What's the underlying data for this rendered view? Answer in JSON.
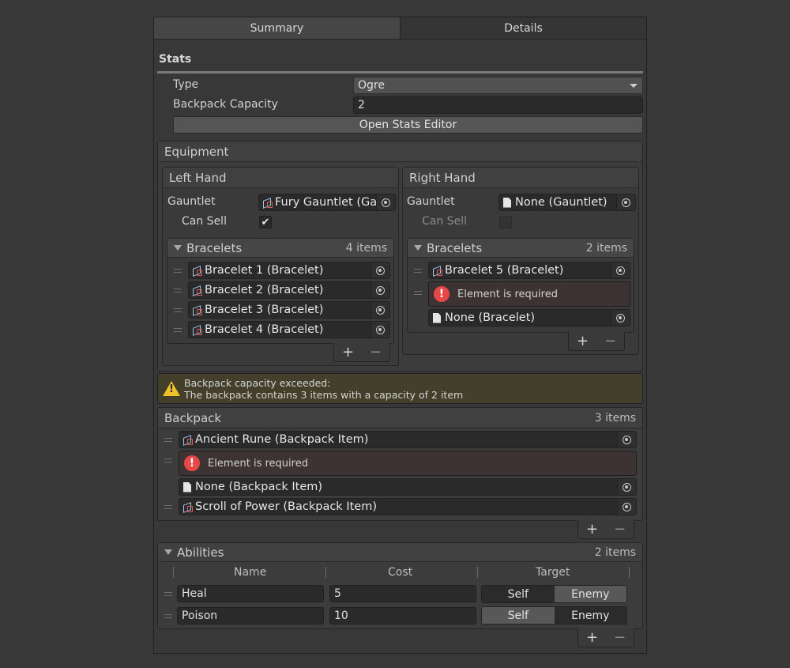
{
  "tabs": [
    "Summary",
    "Details"
  ],
  "stats": {
    "header": "Stats",
    "type_label": "Type",
    "type_value": "Ogre",
    "capacity_label": "Backpack Capacity",
    "capacity_value": "2",
    "open_button": "Open Stats Editor"
  },
  "equipment": {
    "header": "Equipment",
    "left": {
      "title": "Left Hand",
      "gauntlet_label": "Gauntlet",
      "gauntlet_value": "Fury Gauntlet (Gau",
      "can_sell_label": "Can Sell",
      "can_sell_checked": true,
      "bracelets_label": "Bracelets",
      "bracelets_count": "4 items",
      "bracelets": [
        "Bracelet 1 (Bracelet)",
        "Bracelet 2 (Bracelet)",
        "Bracelet 3 (Bracelet)",
        "Bracelet 4 (Bracelet)"
      ]
    },
    "right": {
      "title": "Right Hand",
      "gauntlet_label": "Gauntlet",
      "gauntlet_value": "None (Gauntlet)",
      "can_sell_label": "Can Sell",
      "can_sell_checked": false,
      "bracelets_label": "Bracelets",
      "bracelets_count": "2 items",
      "bracelet_1": "Bracelet 5 (Bracelet)",
      "error": "Element is required",
      "bracelet_2": "None (Bracelet)"
    }
  },
  "warning": {
    "line1": "Backpack capacity exceeded:",
    "line2": "The backpack contains 3 items with a capacity of 2 item"
  },
  "backpack": {
    "header": "Backpack",
    "count": "3 items",
    "item_1": "Ancient Rune (Backpack Item)",
    "error": "Element is required",
    "item_2": "None (Backpack Item)",
    "item_3": "Scroll of Power (Backpack Item)"
  },
  "abilities": {
    "header": "Abilities",
    "count": "2 items",
    "columns": [
      "Name",
      "Cost",
      "Target"
    ],
    "rows": [
      {
        "name": "Heal",
        "cost": "5",
        "self": "Self",
        "enemy": "Enemy",
        "selected": "Enemy"
      },
      {
        "name": "Poison",
        "cost": "10",
        "self": "Self",
        "enemy": "Enemy",
        "selected": "Self"
      }
    ]
  },
  "controls": {
    "plus": "+",
    "minus": "−"
  },
  "icons": [
    "cube-icon",
    "document-icon",
    "object-picker-icon",
    "error-icon",
    "warning-icon",
    "foldout-triangle-icon",
    "drag-handle-icon",
    "checkmark-icon",
    "dropdown-caret-icon"
  ]
}
